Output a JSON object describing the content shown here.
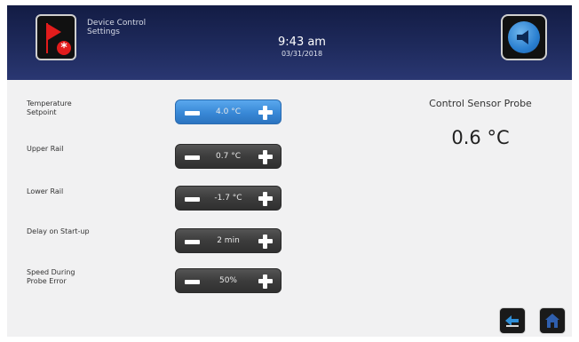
{
  "header": {
    "title_line1": "Device Control",
    "title_line2": "Settings",
    "time": "9:43 am",
    "date": "03/31/2018",
    "alarm_icon": "flag-alarm-icon",
    "sound_icon": "speaker-icon"
  },
  "settings": [
    {
      "label_line1": "Temperature",
      "label_line2": "Setpoint",
      "value": "4.0 °C",
      "active": true
    },
    {
      "label_line1": "Upper Rail",
      "label_line2": "",
      "value": "0.7 °C",
      "active": false
    },
    {
      "label_line1": "Lower Rail",
      "label_line2": "",
      "value": "-1.7 °C",
      "active": false
    },
    {
      "label_line1": "Delay on Start-up",
      "label_line2": "",
      "value": "2 min",
      "active": false
    },
    {
      "label_line1": "Speed During",
      "label_line2": "Probe Error",
      "value": "50%",
      "active": false
    }
  ],
  "sensor": {
    "title": "Control Sensor Probe",
    "value": "0.6 °C"
  },
  "colors": {
    "header_bg": "#1e2a5c",
    "active_stepper": "#3888d6",
    "stepper": "#3c3c3c",
    "alarm": "#e21c1c",
    "home_icon": "#2f5fae",
    "back_icon": "#2f8fd8"
  },
  "footer": {
    "back_icon": "back-arrow-icon",
    "home_icon": "home-icon"
  }
}
